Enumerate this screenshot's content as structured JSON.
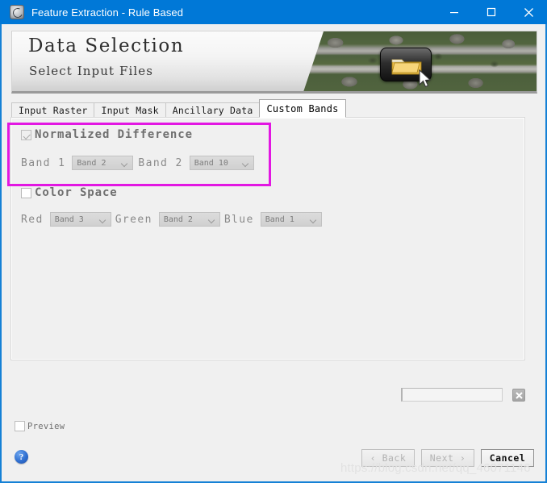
{
  "window": {
    "title": "Feature Extraction - Rule Based",
    "icon": "app-globe-icon",
    "accent_color": "#0078D7",
    "controls": {
      "minimize": "minimize-icon",
      "maximize": "maximize-icon",
      "close": "close-icon"
    }
  },
  "banner": {
    "title": "Data Selection",
    "subtitle": "Select Input Files",
    "image_description": "aerial-suburban-photo",
    "overlay_icon": "folder-icon",
    "cursor": "mouse-pointer-icon"
  },
  "tabs": [
    {
      "label": "Input Raster",
      "active": false
    },
    {
      "label": "Input Mask",
      "active": false
    },
    {
      "label": "Ancillary Data",
      "active": false
    },
    {
      "label": "Custom Bands",
      "active": true
    }
  ],
  "custom_bands": {
    "normalized_difference": {
      "label": "Normalized Difference",
      "checked": true,
      "fields": [
        {
          "label": "Band 1",
          "value": "Band 2"
        },
        {
          "label": "Band 2",
          "value": "Band 10"
        }
      ]
    },
    "color_space": {
      "label": "Color Space",
      "checked": false,
      "fields": [
        {
          "label": "Red",
          "value": "Band 3"
        },
        {
          "label": "Green",
          "value": "Band 2"
        },
        {
          "label": "Blue",
          "value": "Band 1"
        }
      ]
    }
  },
  "annotation": {
    "color": "#E217E2",
    "target": "normalized-difference-group"
  },
  "progress": {
    "value": "",
    "cancel_icon": "cancel-x-icon"
  },
  "footer": {
    "preview": {
      "label": "Preview",
      "checked": false
    },
    "help_icon": "help-question-icon",
    "buttons": [
      {
        "label": "‹ Back",
        "enabled": false
      },
      {
        "label": "Next ›",
        "enabled": false
      },
      {
        "label": "Cancel",
        "enabled": true
      }
    ]
  },
  "watermark": "https://blog.csdn.net/qq_46071146"
}
